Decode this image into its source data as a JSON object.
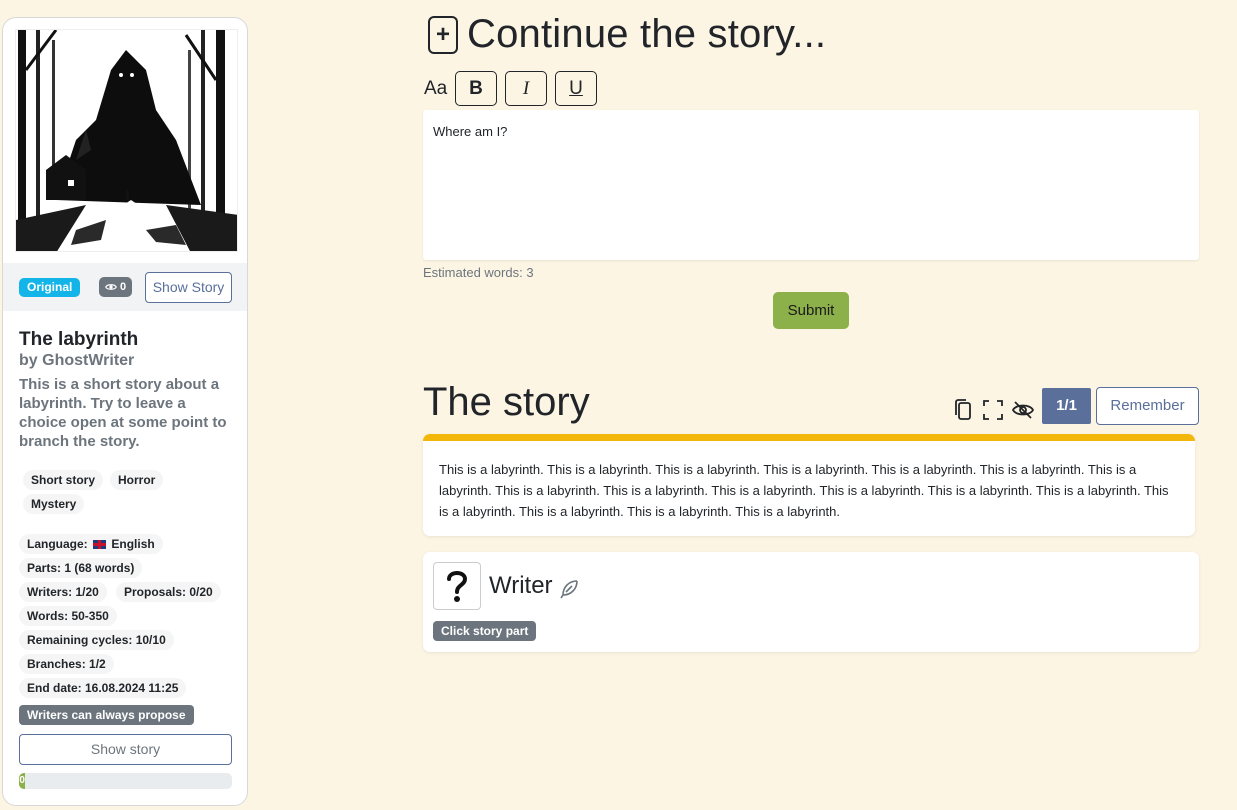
{
  "sidebar": {
    "original_badge": "Original",
    "views_count": "0",
    "show_story_small": "Show Story",
    "title": "The labyrinth",
    "author": "by GhostWriter",
    "description": "This is a short story about a labyrinth. Try to leave a choice open at some point to branch the story.",
    "genres": [
      "Short story",
      "Horror",
      "Mystery"
    ],
    "info": {
      "language_label": "Language:",
      "language_value": "English",
      "parts": "Parts: 1 (68 words)",
      "writers": "Writers: 1/20",
      "proposals": "Proposals: 0/20",
      "words": "Words: 50-350",
      "remaining_cycles": "Remaining cycles: 10/10",
      "branches": "Branches: 1/2",
      "end_date": "End date: 16.08.2024 11:25"
    },
    "propose_badge": "Writers can always propose",
    "show_story_button": "Show story",
    "progress_label": "0",
    "progress_value": 0.03
  },
  "editor": {
    "heading": "Continue the story...",
    "font_label": "Aa",
    "bold": "B",
    "italic": "I",
    "underline": "U",
    "content": "Where am I?",
    "word_count": "Estimated words: 3",
    "submit": "Submit"
  },
  "story": {
    "heading": "The story",
    "page": "1/1",
    "remember": "Remember",
    "part_text": "This is a labyrinth. This is a labyrinth. This is a labyrinth. This is a labyrinth. This is a labyrinth. This is a labyrinth. This is a labyrinth. This is a labyrinth. This is a labyrinth. This is a labyrinth. This is a labyrinth. This is a labyrinth. This is a labyrinth. This is a labyrinth. This is a labyrinth. This is a labyrinth. This is a labyrinth.",
    "writer_name": "Writer",
    "click_badge": "Click story part"
  },
  "colors": {
    "background": "#fdf5e3",
    "accent_blue": "#5a6f9a",
    "submit_green": "#8cb04a",
    "story_bar": "#f2b70a",
    "original_badge": "#13b5e8"
  },
  "icons": [
    "eye-icon",
    "plus-icon",
    "copy-icon",
    "fullscreen-icon",
    "eye-slash-icon",
    "feather-icon",
    "question-avatar-icon",
    "uk-flag-icon"
  ]
}
